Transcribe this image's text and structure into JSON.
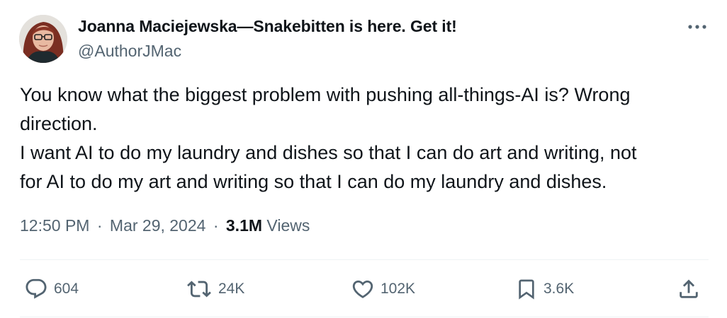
{
  "author": {
    "name": "Joanna Maciejewska—Snakebitten is here. Get it!",
    "handle": "@AuthorJMac"
  },
  "tweet": {
    "lines": [
      "You know what the biggest problem with pushing all-things-AI is? Wrong",
      "direction.",
      "I want AI to do my laundry and dishes so that I can do art and writing, not",
      "for AI to do my art and writing so that I can do my laundry and dishes."
    ]
  },
  "meta": {
    "time": "12:50 PM",
    "separator": "·",
    "date": "Mar 29, 2024",
    "views_count": "3.1M",
    "views_label": "Views"
  },
  "actions": {
    "replies": "604",
    "reposts": "24K",
    "likes": "102K",
    "bookmarks": "3.6K"
  },
  "icons": {
    "more": "more-horizontal-icon",
    "reply": "speech-bubble-icon",
    "repost": "repost-arrows-icon",
    "like": "heart-icon",
    "bookmark": "bookmark-icon",
    "share": "share-upload-icon"
  },
  "colors": {
    "text": "#0f1419",
    "secondary": "#536471",
    "divider": "#eff3f4"
  }
}
